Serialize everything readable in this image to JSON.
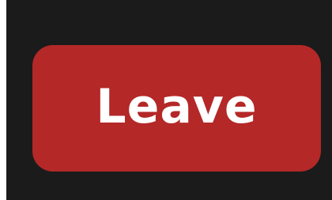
{
  "leave_button": {
    "label": "Leave",
    "background_color": "#b42828",
    "text_color": "#ffffff"
  },
  "frame": {
    "background_color": "#1b1b1b"
  }
}
